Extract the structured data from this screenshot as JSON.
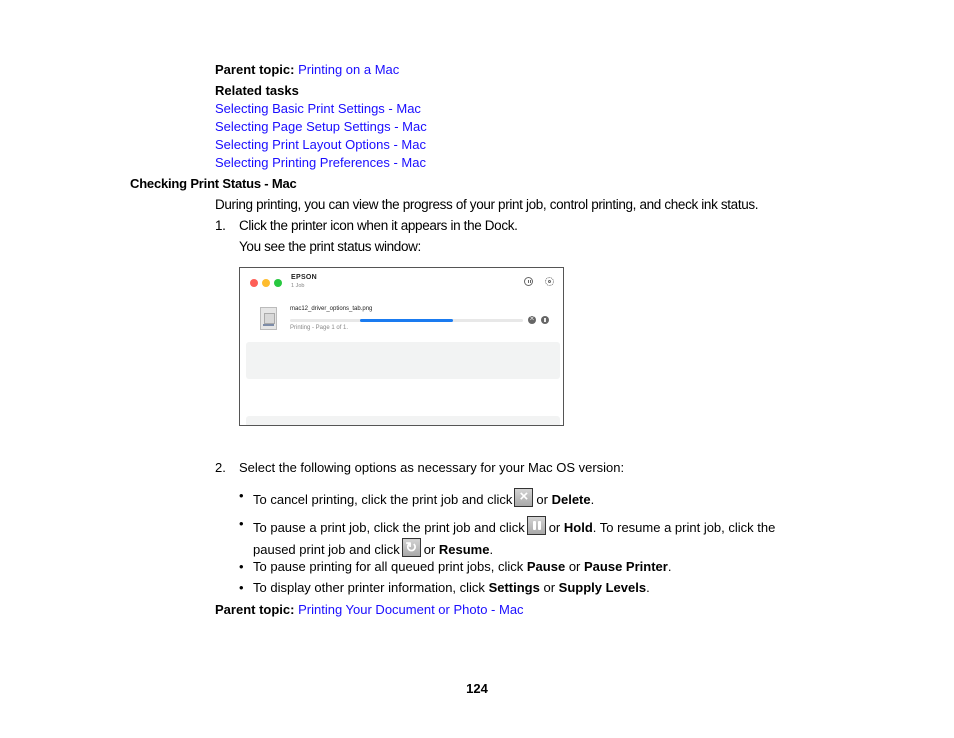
{
  "top_parent_topic": {
    "label": "Parent topic:",
    "link": "Printing on a Mac"
  },
  "related_tasks": {
    "heading": "Related tasks",
    "links": [
      "Selecting Basic Print Settings - Mac",
      "Selecting Page Setup Settings - Mac",
      "Selecting Print Layout Options - Mac",
      "Selecting Printing Preferences - Mac"
    ]
  },
  "section": {
    "title": "Checking Print Status - Mac",
    "intro": "During printing, you can view the progress of your print job, control printing, and check ink status.",
    "step1": {
      "number": "1.",
      "text": "Click the printer icon when it appears in the Dock.",
      "result": "You see the print status window:"
    },
    "window": {
      "printer_name": "EPSON",
      "job_count": "1 Job",
      "file_name": "mac12_driver_options_tab.png",
      "job_status": "Printing - Page 1 of 1.",
      "progress": {
        "start": 0.3,
        "end": 0.7
      },
      "progress_color": "#1a7bf0"
    },
    "step2": {
      "number": "2.",
      "text": "Select the following options as necessary for your Mac OS version:",
      "bullets": [
        {
          "pre": "To cancel printing, click the print job and click",
          "or": "or",
          "bold": "Delete",
          "post": "."
        },
        {
          "pre": "To pause a print job, click the print job and click",
          "or": "or",
          "bold": "Hold",
          "post": ". To resume a print job, click the",
          "line2_pre": "paused print job and click",
          "line2_or": "or",
          "line2_bold": "Resume",
          "line2_post": "."
        },
        {
          "pre": "To pause printing for all queued print jobs, click",
          "bold1": "Pause",
          "or": "or",
          "bold2": "Pause Printer",
          "post": "."
        },
        {
          "pre": "To display other printer information, click",
          "bold1": "Settings",
          "or": "or",
          "bold2": "Supply Levels",
          "post": "."
        }
      ],
      "bullet_char": "•"
    }
  },
  "bottom_parent_topic": {
    "label": "Parent topic:",
    "link": "Printing Your Document or Photo - Mac"
  },
  "page_number": "124",
  "colors": {
    "link": "#1a0dff"
  }
}
